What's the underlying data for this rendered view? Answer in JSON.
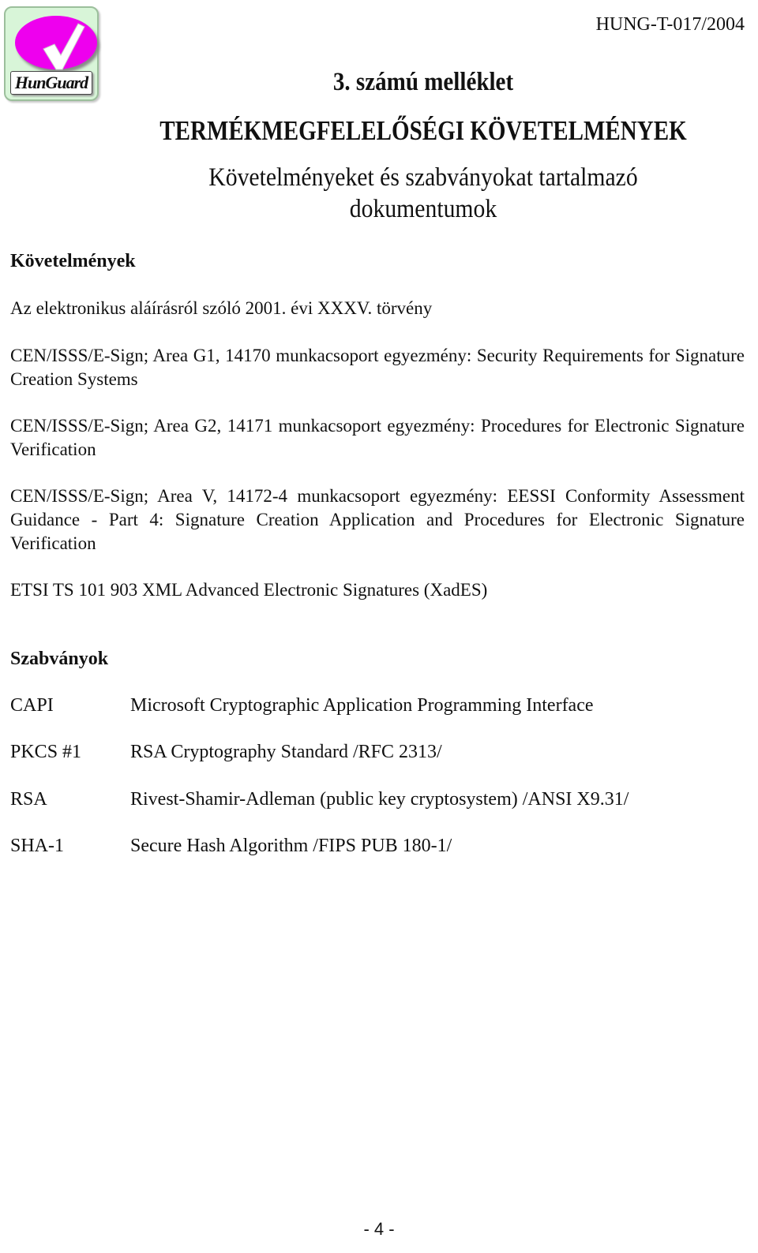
{
  "header": {
    "logo": {
      "icon": "checkmark-icon",
      "wordmark": "HunGuard",
      "colors": {
        "background": "#d8f5d8",
        "oval": "#ee00ee",
        "check": "#ffffff"
      }
    },
    "document_id": "HUNG-T-017/2004",
    "annex_title": "3. számú melléklet",
    "main_title": "TERMÉKMEGFELELŐSÉGI KÖVETELMÉNYEK",
    "subtitle_line1": "Követelményeket és szabványokat tartalmazó",
    "subtitle_line2": "dokumentumok"
  },
  "requirements": {
    "heading": "Követelmények",
    "items": [
      "Az elektronikus aláírásról szóló 2001. évi XXXV. törvény",
      "CEN/ISSS/E-Sign; Area G1, 14170 munkacsoport egyezmény: Security Requirements for Signature Creation Systems",
      "CEN/ISSS/E-Sign; Area G2, 14171 munkacsoport egyezmény: Procedures for Electronic Signature Verification",
      "CEN/ISSS/E-Sign; Area V, 14172-4 munkacsoport egyezmény: EESSI Conformity Assessment Guidance - Part 4: Signature Creation Application and Procedures for Electronic Signature Verification",
      "ETSI TS 101 903 XML Advanced Electronic Signatures (XadES)"
    ]
  },
  "standards": {
    "heading": "Szabványok",
    "items": [
      {
        "code": "CAPI",
        "description": "Microsoft Cryptographic Application Programming Interface"
      },
      {
        "code": "PKCS #1",
        "description": "RSA Cryptography Standard /RFC 2313/"
      },
      {
        "code": "RSA",
        "description": "Rivest-Shamir-Adleman (public key cryptosystem) /ANSI X9.31/"
      },
      {
        "code": "SHA-1",
        "description": "Secure Hash Algorithm /FIPS PUB 180-1/"
      }
    ]
  },
  "footer": {
    "page_number": "- 4 -"
  }
}
